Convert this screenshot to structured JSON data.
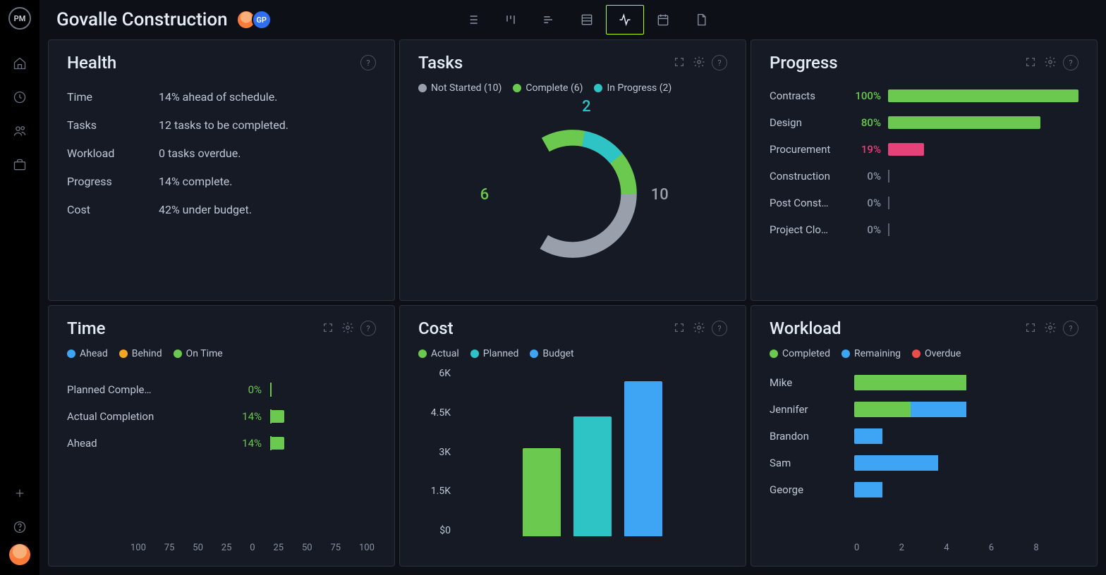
{
  "app": {
    "logo_text": "PM",
    "project_title": "Govalle Construction",
    "avatar2_text": "GP"
  },
  "cards": {
    "health": {
      "title": "Health",
      "rows": [
        {
          "k": "Time",
          "v": "14% ahead of schedule."
        },
        {
          "k": "Tasks",
          "v": "12 tasks to be completed."
        },
        {
          "k": "Workload",
          "v": "0 tasks overdue."
        },
        {
          "k": "Progress",
          "v": "14% complete."
        },
        {
          "k": "Cost",
          "v": "42% under budget."
        }
      ]
    },
    "tasks": {
      "title": "Tasks",
      "legend": [
        {
          "label": "Not Started (10)",
          "color": "#9aa0ab"
        },
        {
          "label": "Complete (6)",
          "color": "#6bc950"
        },
        {
          "label": "In Progress (2)",
          "color": "#2ec4c6"
        }
      ],
      "callouts": {
        "top": "2",
        "left": "6",
        "right": "10"
      }
    },
    "progress": {
      "title": "Progress",
      "rows": [
        {
          "label": "Contracts",
          "pct": "100%",
          "w": 100,
          "color": "#6bc950"
        },
        {
          "label": "Design",
          "pct": "80%",
          "w": 80,
          "color": "#6bc950"
        },
        {
          "label": "Procurement",
          "pct": "19%",
          "w": 19,
          "color": "#e6427a"
        },
        {
          "label": "Construction",
          "pct": "0%",
          "w": 0,
          "color": "#6bc950"
        },
        {
          "label": "Post Const…",
          "pct": "0%",
          "w": 0,
          "color": "#6bc950"
        },
        {
          "label": "Project Clo…",
          "pct": "0%",
          "w": 0,
          "color": "#6bc950"
        }
      ]
    },
    "time": {
      "title": "Time",
      "legend": [
        {
          "label": "Ahead",
          "color": "#3da5f4"
        },
        {
          "label": "Behind",
          "color": "#f5a623"
        },
        {
          "label": "On Time",
          "color": "#6bc950"
        }
      ],
      "rows": [
        {
          "label": "Planned Comple…",
          "pct": "0%",
          "w": 0
        },
        {
          "label": "Actual Completion",
          "pct": "14%",
          "w": 14
        },
        {
          "label": "Ahead",
          "pct": "14%",
          "w": 14
        }
      ],
      "axis": [
        "100",
        "75",
        "50",
        "25",
        "0",
        "25",
        "50",
        "75",
        "100"
      ]
    },
    "cost": {
      "title": "Cost",
      "legend": [
        {
          "label": "Actual",
          "color": "#6bc950"
        },
        {
          "label": "Planned",
          "color": "#2ec4c6"
        },
        {
          "label": "Budget",
          "color": "#3da5f4"
        }
      ],
      "yticks": [
        "6K",
        "4.5K",
        "3K",
        "1.5K",
        "$0"
      ]
    },
    "workload": {
      "title": "Workload",
      "legend": [
        {
          "label": "Completed",
          "color": "#6bc950"
        },
        {
          "label": "Remaining",
          "color": "#3da5f4"
        },
        {
          "label": "Overdue",
          "color": "#eb4d4b"
        }
      ],
      "axis": [
        "0",
        "2",
        "4",
        "6",
        "8"
      ]
    }
  },
  "chart_data": [
    {
      "type": "pie",
      "title": "Tasks",
      "series": [
        {
          "name": "Not Started",
          "value": 10,
          "color": "#9aa0ab"
        },
        {
          "name": "Complete",
          "value": 6,
          "color": "#6bc950"
        },
        {
          "name": "In Progress",
          "value": 2,
          "color": "#2ec4c6"
        }
      ]
    },
    {
      "type": "bar",
      "title": "Progress",
      "orientation": "horizontal",
      "xlabel": "",
      "ylabel": "",
      "xlim": [
        0,
        100
      ],
      "categories": [
        "Contracts",
        "Design",
        "Procurement",
        "Construction",
        "Post Construction",
        "Project Closure"
      ],
      "values": [
        100,
        80,
        19,
        0,
        0,
        0
      ]
    },
    {
      "type": "bar",
      "title": "Time",
      "orientation": "horizontal",
      "xlabel": "",
      "ylabel": "",
      "xlim": [
        -100,
        100
      ],
      "categories": [
        "Planned Completion",
        "Actual Completion",
        "Ahead"
      ],
      "values": [
        0,
        14,
        14
      ]
    },
    {
      "type": "bar",
      "title": "Cost",
      "xlabel": "",
      "ylabel": "",
      "ylim": [
        0,
        6000
      ],
      "categories": [
        "Actual",
        "Planned",
        "Budget"
      ],
      "values": [
        3400,
        4650,
        6000
      ]
    },
    {
      "type": "bar",
      "title": "Workload",
      "orientation": "horizontal",
      "stacked": true,
      "xlabel": "",
      "ylabel": "",
      "xlim": [
        0,
        8
      ],
      "categories": [
        "Mike",
        "Jennifer",
        "Brandon",
        "Sam",
        "George"
      ],
      "series": [
        {
          "name": "Completed",
          "values": [
            4,
            2,
            0,
            0,
            0
          ],
          "color": "#6bc950"
        },
        {
          "name": "Remaining",
          "values": [
            0,
            2,
            1,
            3,
            1
          ],
          "color": "#3da5f4"
        },
        {
          "name": "Overdue",
          "values": [
            0,
            0,
            0,
            0,
            0
          ],
          "color": "#eb4d4b"
        }
      ]
    }
  ]
}
